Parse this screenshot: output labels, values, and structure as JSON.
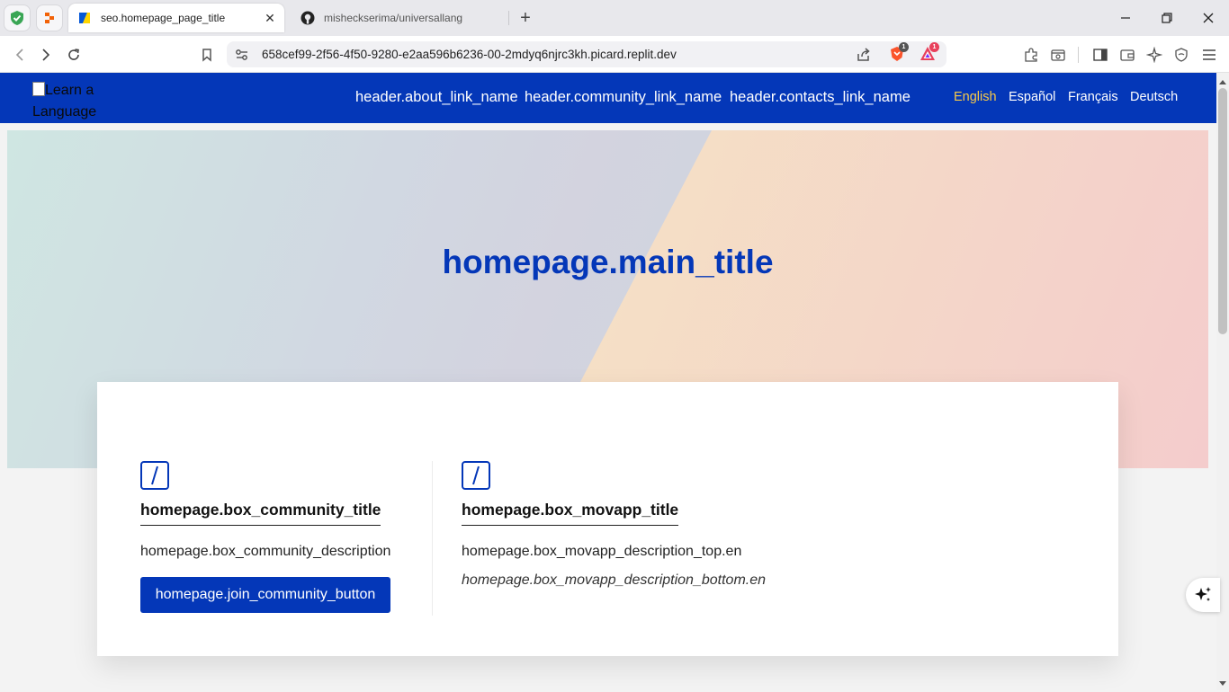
{
  "browser": {
    "tabs": [
      {
        "title": "seo.homepage_page_title",
        "active": true
      },
      {
        "title": "misheckserima/universallang",
        "active": false
      }
    ],
    "url": "658cef99-2f56-4f50-9280-e2aa596b6236-00-2mdyq6njrc3kh.picard.replit.dev",
    "brave_badge": "1",
    "rewards_badge": "1"
  },
  "header": {
    "logo_alt": "Learn a Language",
    "nav": [
      {
        "label": "header.about_link_name"
      },
      {
        "label": "header.community_link_name"
      },
      {
        "label": "header.contacts_link_name"
      }
    ],
    "languages": [
      {
        "label": "English",
        "active": true
      },
      {
        "label": "Español",
        "active": false
      },
      {
        "label": "Français",
        "active": false
      },
      {
        "label": "Deutsch",
        "active": false
      }
    ]
  },
  "hero": {
    "title": "homepage.main_title"
  },
  "boxes": {
    "community": {
      "title": "homepage.box_community_title",
      "description": "homepage.box_community_description",
      "button": "homepage.join_community_button"
    },
    "movapp": {
      "title": "homepage.box_movapp_title",
      "description_top": "homepage.box_movapp_description_top.en",
      "description_bottom": "homepage.box_movapp_description_bottom.en"
    }
  },
  "colors": {
    "brand_blue": "#0437b8",
    "active_language": "#f7c948"
  }
}
